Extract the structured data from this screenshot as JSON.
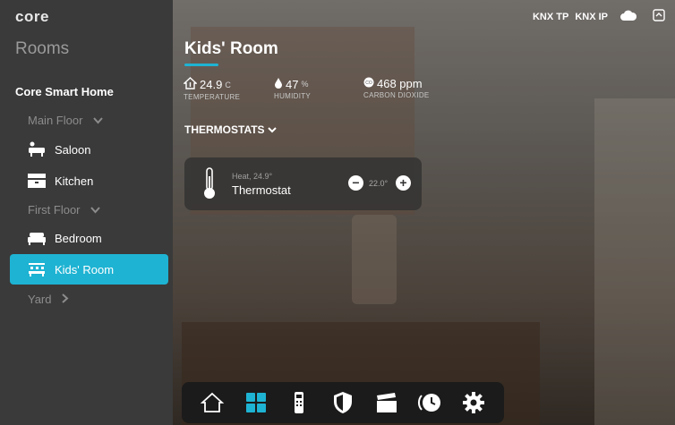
{
  "app": {
    "logo": "core"
  },
  "sidebar": {
    "title": "Rooms",
    "home": "Core Smart Home",
    "floors": [
      {
        "label": "Main Floor"
      },
      {
        "label": "First Floor"
      },
      {
        "label": "Yard"
      }
    ],
    "rooms": [
      {
        "label": "Saloon",
        "icon": "sofa-icon"
      },
      {
        "label": "Kitchen",
        "icon": "kitchen-icon"
      },
      {
        "label": "Bedroom",
        "icon": "bed-icon"
      },
      {
        "label": "Kids' Room",
        "icon": "kids-room-icon",
        "active": true
      }
    ]
  },
  "main": {
    "title": "Kids' Room",
    "stats": {
      "temperature": {
        "value": "24.9",
        "unit": "C",
        "label": "TEMPERATURE"
      },
      "humidity": {
        "value": "47",
        "unit": "%",
        "label": "HUMIDITY"
      },
      "co2": {
        "value": "468 ppm",
        "label": "CARBON DIOXIDE"
      }
    },
    "section": "THERMOSTATS",
    "thermostat": {
      "mode": "Heat, 24.9°",
      "name": "Thermostat",
      "setpoint": "22.0°"
    }
  },
  "topbar": {
    "knx_tp": "KNX TP",
    "knx_ip": "KNX IP"
  },
  "dock": [
    "home-icon",
    "rooms-grid-icon",
    "remote-icon",
    "security-shield-icon",
    "scenes-clapper-icon",
    "schedule-clock-icon",
    "settings-gear-icon"
  ],
  "colors": {
    "accent": "#1eb3d3",
    "sidebar": "#3a3a3a",
    "dock": "#1b1b1b"
  }
}
